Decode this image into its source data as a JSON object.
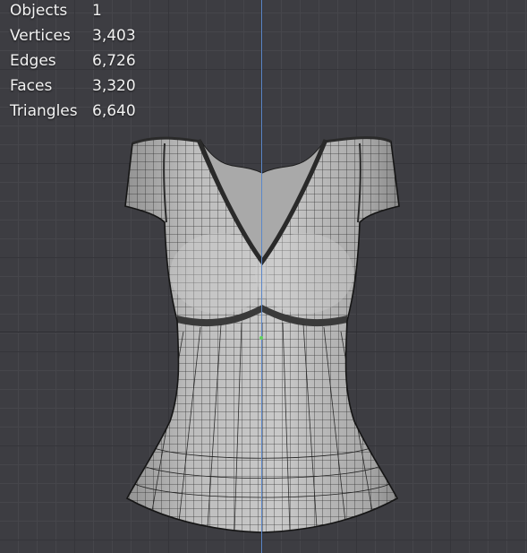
{
  "stats": [
    {
      "label": "Objects",
      "value": "1"
    },
    {
      "label": "Vertices",
      "value": "3,403"
    },
    {
      "label": "Edges",
      "value": "6,726"
    },
    {
      "label": "Faces",
      "value": "3,320"
    },
    {
      "label": "Triangles",
      "value": "6,640"
    }
  ],
  "colors": {
    "background": "#3d3d42",
    "mesh_fill": "#b8b8b8",
    "wire": "#1e1e1e",
    "z_axis": "#5b87c9",
    "origin": "#5fd35f"
  }
}
